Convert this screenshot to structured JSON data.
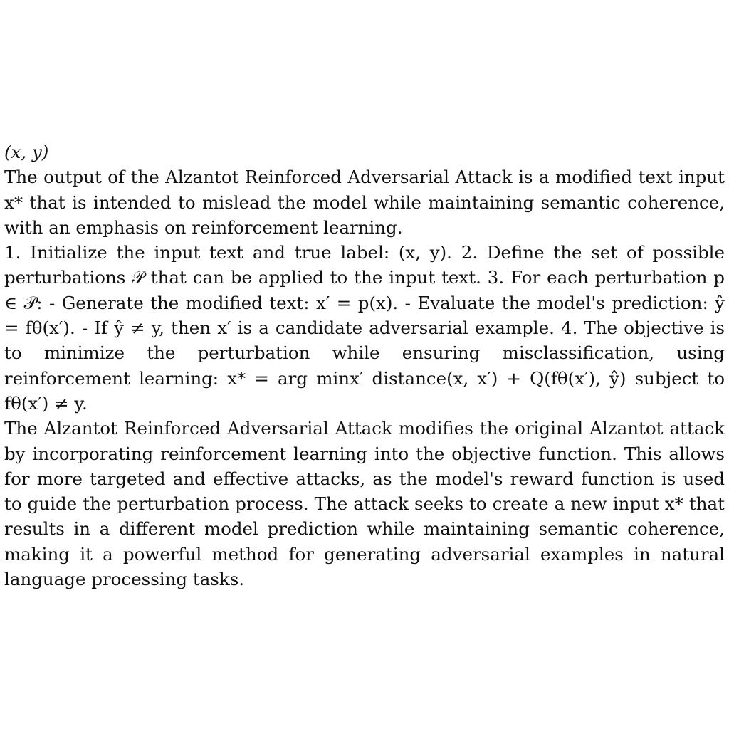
{
  "document": {
    "heading_math": "(x, y)",
    "output_paragraph": "The output of the Alzantot Reinforced Adversarial Attack is a modified text input x* that is intended to mislead the model while maintaining semantic coherence, with an emphasis on reinforcement learning.",
    "steps_paragraph": "1. Initialize the input text and true label: (x, y). 2. Define the set of possible perturbations 𝒫 that can be applied to the input text. 3. For each perturbation p ∈ 𝒫: - Generate the modified text: x′ = p(x). - Evaluate the model's prediction: ŷ = fθ(x′). - If ŷ ≠ y, then x′ is a candidate adversarial example. 4. The objective is to minimize the perturbation while ensuring misclassification, using reinforcement learning: x* = arg minx′ distance(x, x′) + Q(fθ(x′), ŷ)  subject to fθ(x′) ≠ y.",
    "summary_paragraph": "The Alzantot Reinforced Adversarial Attack modifies the original Alzantot attack by incorporating reinforcement learning into the objective function. This allows for more targeted and effective attacks, as the model's reward function is used to guide the perturbation process. The attack seeks to create a new input x* that results in a different model prediction while maintaining semantic coherence, making it a powerful method for generating adversarial examples in natural language processing tasks."
  }
}
